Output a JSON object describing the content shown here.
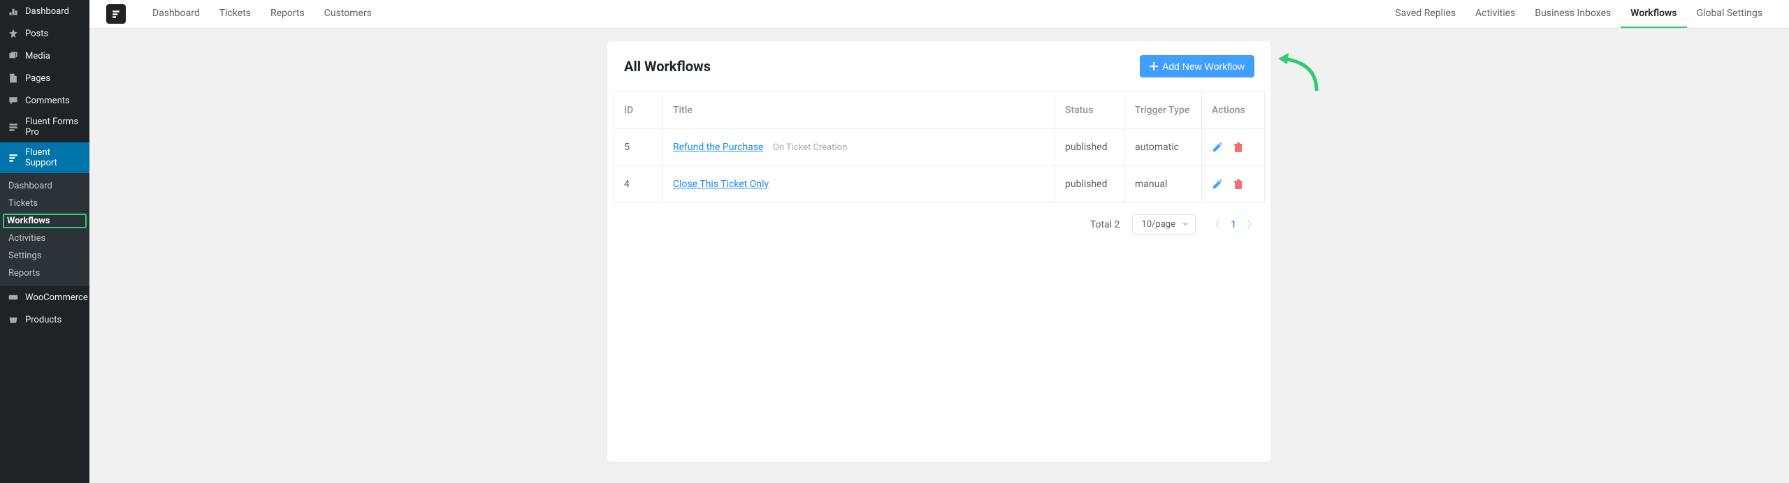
{
  "wp_sidebar": {
    "items": [
      {
        "label": "Dashboard",
        "icon": "dashboard"
      },
      {
        "label": "Posts",
        "icon": "pin"
      },
      {
        "label": "Media",
        "icon": "media"
      },
      {
        "label": "Pages",
        "icon": "page"
      },
      {
        "label": "Comments",
        "icon": "comment"
      },
      {
        "label": "Fluent Forms Pro",
        "icon": "forms"
      },
      {
        "label": "Fluent Support",
        "icon": "support",
        "active": true
      },
      {
        "label": "WooCommerce",
        "icon": "woo"
      },
      {
        "label": "Products",
        "icon": "product"
      }
    ],
    "sub": [
      {
        "label": "Dashboard"
      },
      {
        "label": "Tickets"
      },
      {
        "label": "Workflows",
        "highlighted": true
      },
      {
        "label": "Activities"
      },
      {
        "label": "Settings"
      },
      {
        "label": "Reports"
      }
    ]
  },
  "topnav": {
    "left": [
      "Dashboard",
      "Tickets",
      "Reports",
      "Customers"
    ],
    "right": [
      "Saved Replies",
      "Activities",
      "Business Inboxes",
      "Workflows",
      "Global Settings"
    ],
    "active_right_index": 3
  },
  "card": {
    "title": "All Workflows",
    "add_button": "Add New Workflow",
    "columns": [
      "ID",
      "Title",
      "Status",
      "Trigger Type",
      "Actions"
    ],
    "rows": [
      {
        "id": "5",
        "title": "Refund the Purchase",
        "sub": "On Ticket Creation",
        "status": "published",
        "trigger": "automatic"
      },
      {
        "id": "4",
        "title": "Close This Ticket Only",
        "sub": "",
        "status": "published",
        "trigger": "manual"
      }
    ],
    "footer": {
      "total": "Total 2",
      "per_page": "10/page",
      "current_page": "1"
    }
  }
}
